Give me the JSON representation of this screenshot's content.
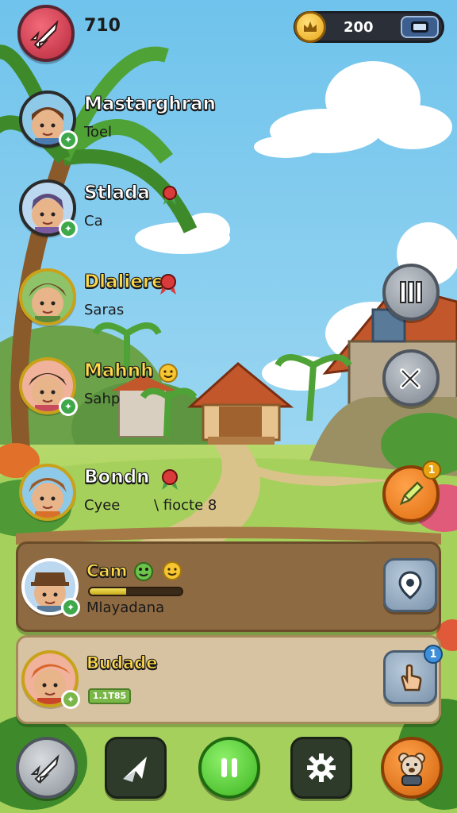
{
  "hud": {
    "score": "710",
    "coins": "200"
  },
  "players": [
    {
      "name": "Mastarghran",
      "sub": "Toel",
      "name_color": "white",
      "avatar_bg": "#8ec9e8",
      "skin": "#e8b48a",
      "hair": "#6b3b1d",
      "ring": "#a7c9ec",
      "badge": "green"
    },
    {
      "name": "Stlada",
      "sub": "Ca",
      "name_color": "white",
      "avatar_bg": "#bcd8f0",
      "skin": "#e8b48a",
      "hair": "#5c4a7d",
      "ring": "#a7c9ec",
      "badge": "green"
    },
    {
      "name": "Dlaliere",
      "sub": "Saras",
      "name_color": "yellow",
      "avatar_bg": "#8fc36a",
      "skin": "#e8b48a",
      "hair": "#6b4322",
      "ring": "#9acd5a",
      "badge": "none"
    },
    {
      "name": "Mahnh",
      "sub": "Sahp",
      "name_color": "yellow",
      "avatar_bg": "#f0b29a",
      "skin": "#e8b48a",
      "hair": "#3b2a1c",
      "ring": "#f0c24a",
      "badge": "green"
    },
    {
      "name": "Bondn",
      "sub": "Cyee",
      "sub2": "\\ fiocte 8",
      "name_color": "white",
      "avatar_bg": "#8ec9e8",
      "skin": "#e8b48a",
      "hair": "#9a5a2a",
      "ring": "#f0c24a",
      "badge": "none"
    },
    {
      "name": "Cam",
      "sub": "Mlayadana",
      "name_color": "yellow",
      "avatar_bg": "#bcd8f0",
      "skin": "#e8b48a",
      "hair": "#6b4322",
      "ring": "#ffffff",
      "badge": "green",
      "progress": 0.4
    },
    {
      "name": "Budade",
      "sub": "",
      "tag": "1.1T85",
      "name_color": "yellow",
      "avatar_bg": "#f0b29a",
      "skin": "#e8b48a",
      "hair": "#d9662a",
      "ring": "#f0c24a",
      "badge": "green"
    }
  ],
  "side_buttons": {
    "edit_notification": "1",
    "hand_notification": "1"
  },
  "colors": {
    "sky_top": "#7ecbee",
    "grass": "#9ccb5a",
    "brown_card": "#8e6a42",
    "beige_card": "#d7c3a1",
    "play_green": "#5bd13a"
  },
  "icons": {
    "top_avatar": "rocket-icon",
    "coin": "crown-coin-icon",
    "plus": "wallet-icon"
  }
}
